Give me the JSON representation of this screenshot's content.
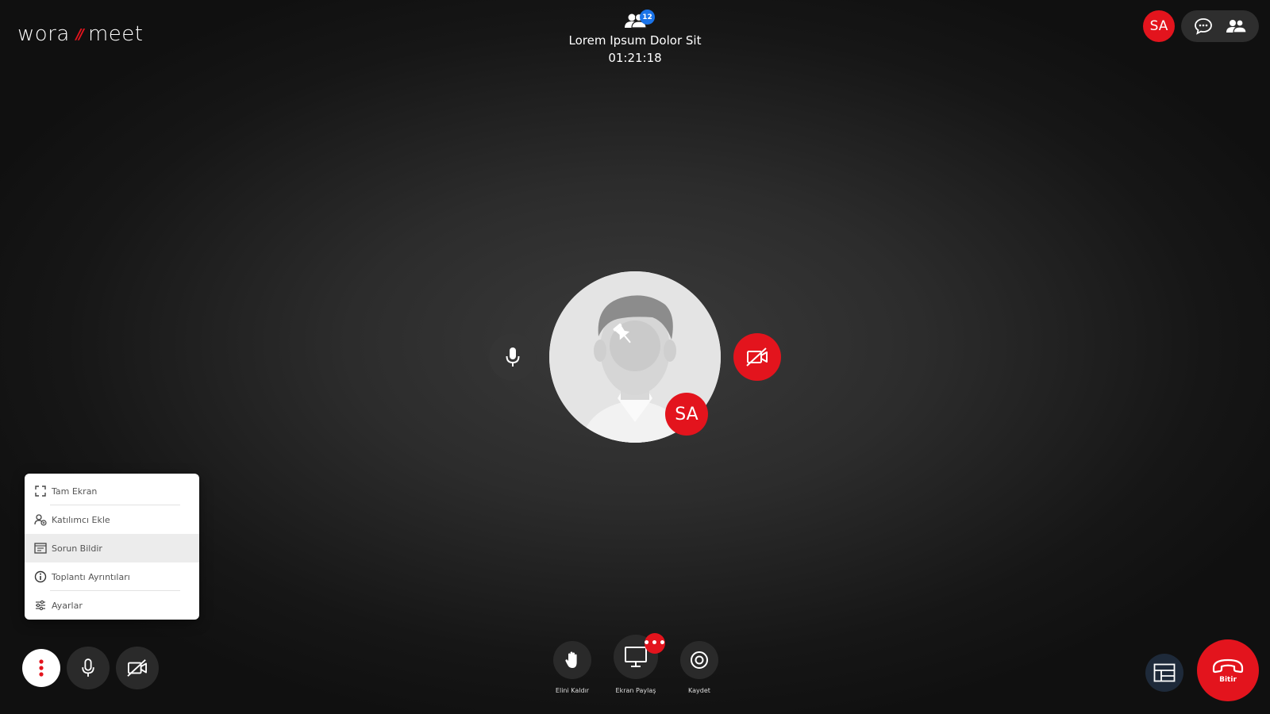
{
  "app": {
    "logo_part1": "wora",
    "logo_sep": "//",
    "logo_part2": "meet"
  },
  "meeting": {
    "participant_count": "12",
    "title": "Lorem Ipsum Dolor Sit",
    "duration": "01:21:18"
  },
  "header": {
    "user_initials": "SA",
    "chat_icon": "chat-icon",
    "participants_icon": "participants-icon"
  },
  "stage": {
    "participant_initials": "SA",
    "mic_state": "on",
    "camera_state": "off"
  },
  "menu": {
    "items": [
      {
        "label": "Tam Ekran",
        "icon": "fullscreen-icon"
      },
      {
        "label": "Katılımcı Ekle",
        "icon": "add-participant-icon"
      },
      {
        "label": "Sorun Bildir",
        "icon": "report-icon"
      },
      {
        "label": "Toplantı Ayrıntıları",
        "icon": "info-icon"
      },
      {
        "label": "Ayarlar",
        "icon": "settings-icon"
      }
    ]
  },
  "toolbar": {
    "raise_hand_label": "Elini Kaldır",
    "share_screen_label": "Ekran Paylaş",
    "record_label": "Kaydet",
    "share_more_badge": "•••",
    "end_call_label": "Bitir"
  },
  "colors": {
    "accent": "#e3141d",
    "badge_blue": "#1a73e8",
    "background": "#1c1c1c"
  }
}
